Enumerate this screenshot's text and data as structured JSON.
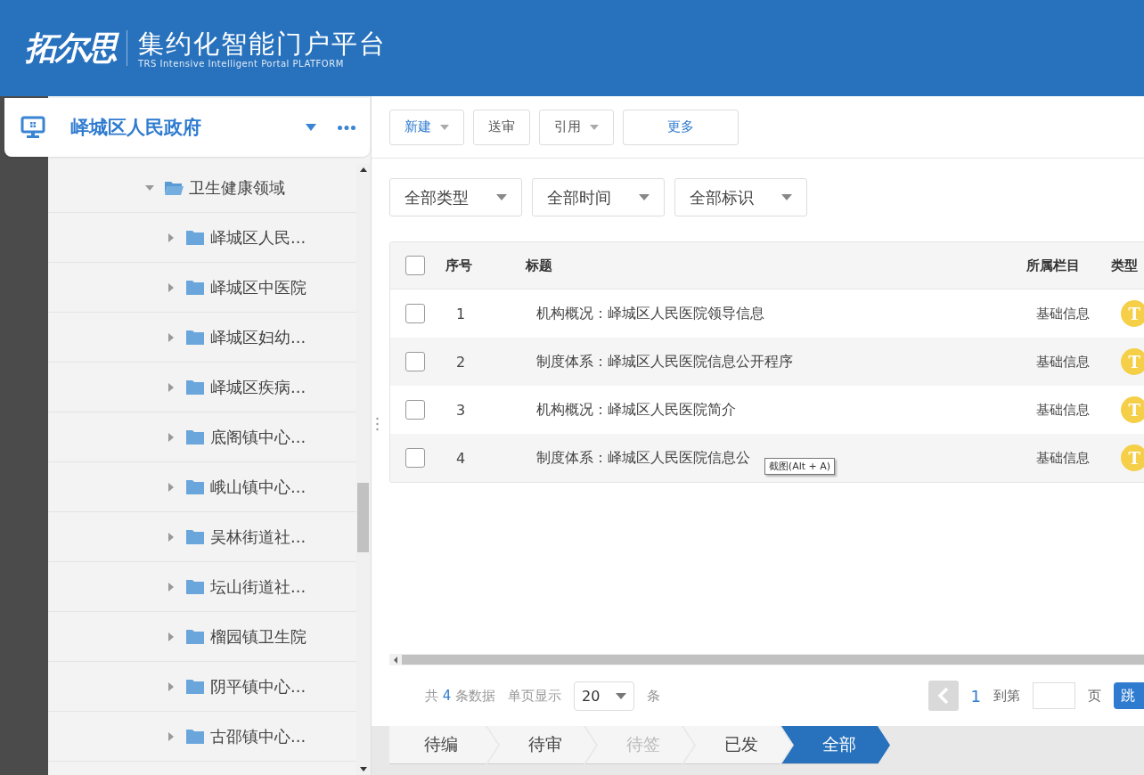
{
  "header": {
    "logo": "拓尔思",
    "title": "集约化智能门户平台",
    "subtitle": "TRS Intensive Intelligent Portal PLATFORM"
  },
  "site": {
    "name": "峄城区人民政府"
  },
  "tree": {
    "label": "卫生健康领域",
    "expanded": true,
    "children": [
      {
        "label": "峄城区人民...",
        "expanded": false
      },
      {
        "label": "峄城区中医院",
        "expanded": false
      },
      {
        "label": "峄城区妇幼...",
        "expanded": false
      },
      {
        "label": "峄城区疾病...",
        "expanded": false
      },
      {
        "label": "底阁镇中心...",
        "expanded": false
      },
      {
        "label": "峨山镇中心...",
        "expanded": false
      },
      {
        "label": "吴林街道社...",
        "expanded": false
      },
      {
        "label": "坛山街道社...",
        "expanded": false
      },
      {
        "label": "榴园镇卫生院",
        "expanded": false
      },
      {
        "label": "阴平镇中心...",
        "expanded": false
      },
      {
        "label": "古邵镇中心...",
        "expanded": false
      }
    ]
  },
  "toolbar": [
    {
      "label": "新建",
      "kind": "dropdown",
      "accent": true
    },
    {
      "label": "送审",
      "kind": "button",
      "accent": false
    },
    {
      "label": "引用",
      "kind": "dropdown",
      "accent": false
    },
    {
      "label": "更多",
      "kind": "wide",
      "accent": true
    }
  ],
  "filters": [
    "全部类型",
    "全部时间",
    "全部标识"
  ],
  "table": {
    "columns": [
      "序号",
      "标题",
      "所属栏目",
      "类型"
    ],
    "header_checked": false,
    "rows": [
      {
        "checked": false,
        "index": "1",
        "title": "机构概况：峄城区人民医院领导信息",
        "column": "基础信息",
        "type": "T"
      },
      {
        "checked": false,
        "index": "2",
        "title": "制度体系：峄城区人民医院信息公开程序",
        "column": "基础信息",
        "type": "T"
      },
      {
        "checked": false,
        "index": "3",
        "title": "机构概况：峄城区人民医院简介",
        "column": "基础信息",
        "type": "T"
      },
      {
        "checked": false,
        "index": "4",
        "title": "制度体系：峄城区人民医院信息公",
        "column": "基础信息",
        "type": "T"
      }
    ]
  },
  "tooltip": "截图(Alt + A)",
  "pager": {
    "total_prefix": "共",
    "total": "4",
    "total_suffix": "条数据",
    "page_size_label": "单页显示",
    "page_size": "20",
    "unit": "条",
    "current_page": "1",
    "goto_label": "到第",
    "page_unit": "页",
    "jump": "跳"
  },
  "status_tabs": [
    {
      "label": "待编",
      "selected": false,
      "disabled": false
    },
    {
      "label": "待审",
      "selected": false,
      "disabled": false
    },
    {
      "label": "待签",
      "selected": false,
      "disabled": true
    },
    {
      "label": "已发",
      "selected": false,
      "disabled": false
    },
    {
      "label": "全部",
      "selected": true,
      "disabled": false
    }
  ]
}
